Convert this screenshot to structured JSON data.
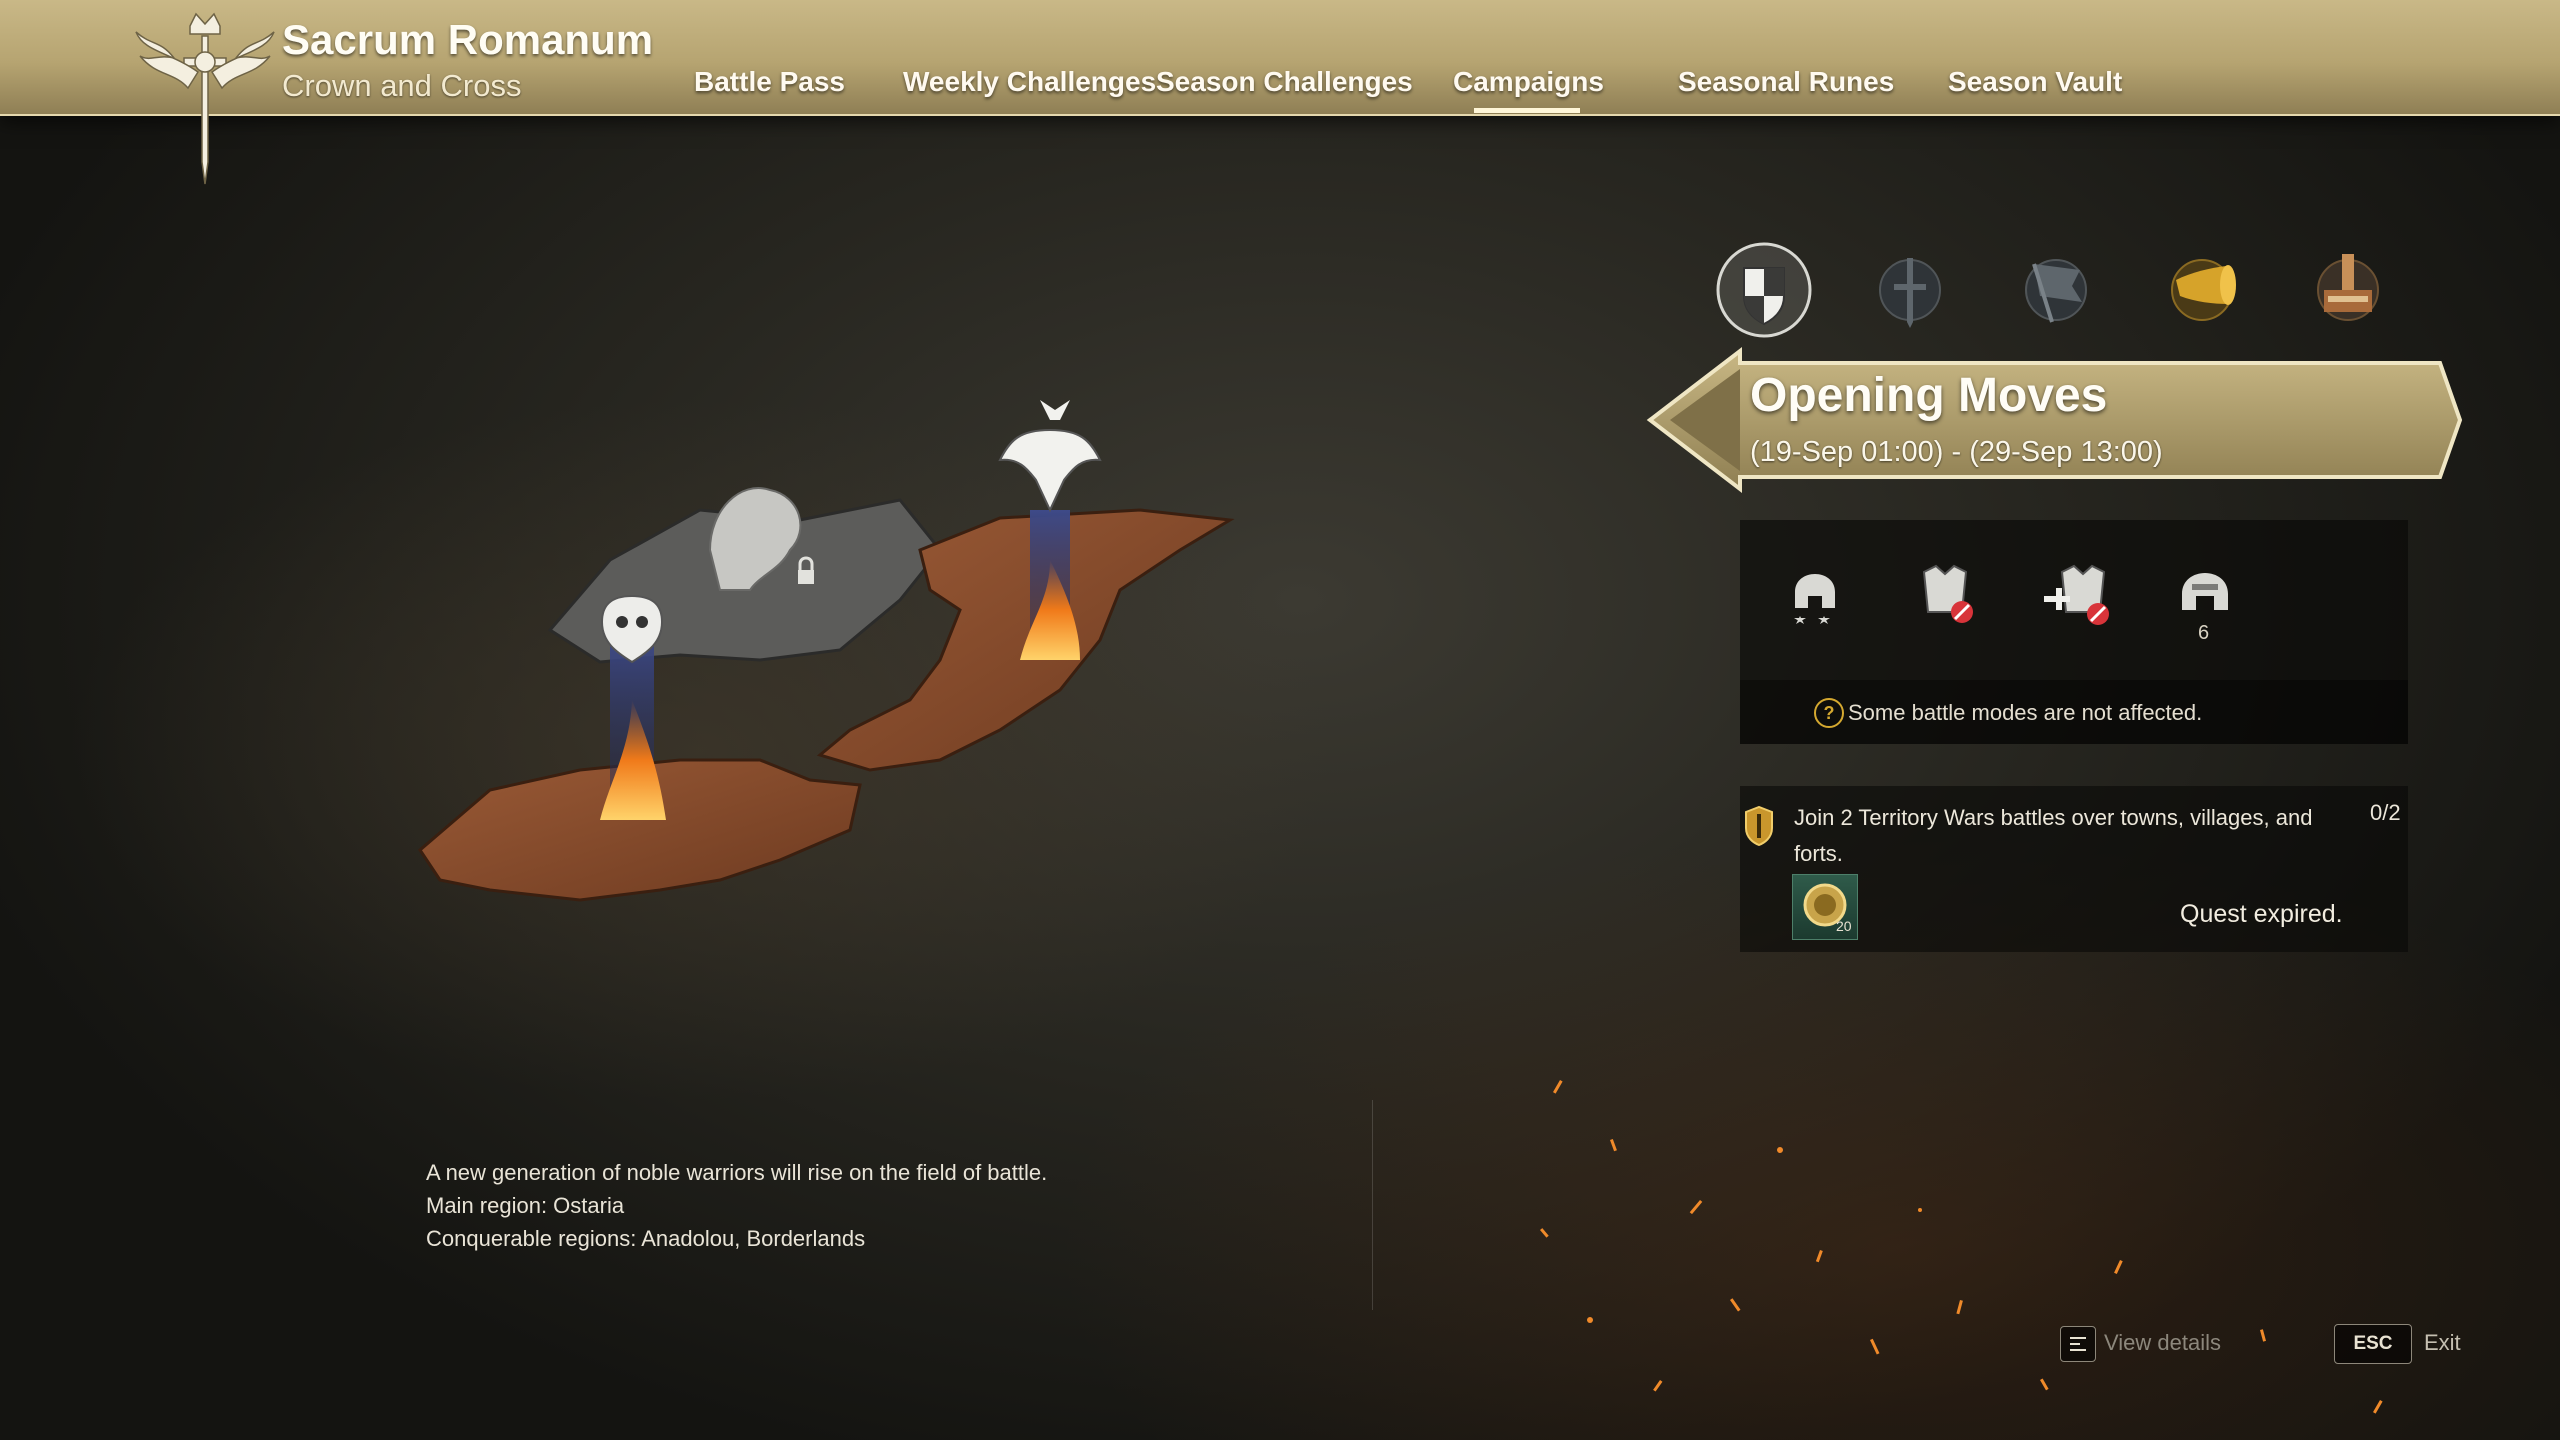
{
  "header": {
    "title": "Sacrum Romanum",
    "subtitle": "Crown and Cross",
    "nav": [
      {
        "label": "Battle Pass"
      },
      {
        "label": "Weekly Challenges"
      },
      {
        "label": "Season Challenges"
      },
      {
        "label": "Campaigns",
        "active": true
      },
      {
        "label": "Seasonal Runes"
      },
      {
        "label": "Season Vault"
      }
    ]
  },
  "map": {
    "description_lines": [
      "A new generation of noble warriors will rise on the field of battle.",
      "Main region: Ostaria",
      "Conquerable regions: Anadolou, Borderlands"
    ],
    "regions": [
      "locked-region-lion",
      "region-eagle-crown",
      "region-owl"
    ]
  },
  "campaign_tabs": [
    {
      "icon": "shield-crest-icon",
      "active": true
    },
    {
      "icon": "sword-emblem-icon",
      "active": false
    },
    {
      "icon": "banner-flag-icon",
      "active": false
    },
    {
      "icon": "war-horn-icon",
      "active": false
    },
    {
      "icon": "fortress-tower-icon",
      "active": false
    }
  ],
  "campaign": {
    "title": "Opening Moves",
    "dates": "(19-Sep 01:00) - (29-Sep 13:00)",
    "modifiers": [
      {
        "icon": "helmet-stars-icon"
      },
      {
        "icon": "armor-banned-icon"
      },
      {
        "icon": "healing-armor-banned-icon"
      },
      {
        "icon": "helmet-count-icon",
        "count": "6"
      }
    ],
    "note": "Some battle modes are not affected."
  },
  "quest": {
    "text": "Join 2 Territory Wars battles over towns, villages, and forts.",
    "progress": "0/2",
    "reward_qty": "20",
    "status": "Quest expired."
  },
  "footer": {
    "view_details": "View details",
    "esc_key": "ESC",
    "exit": "Exit"
  },
  "colors": {
    "header_gold": "#b6a471",
    "panel_dark": "#0a0a09",
    "ember_orange": "#e0781e"
  }
}
